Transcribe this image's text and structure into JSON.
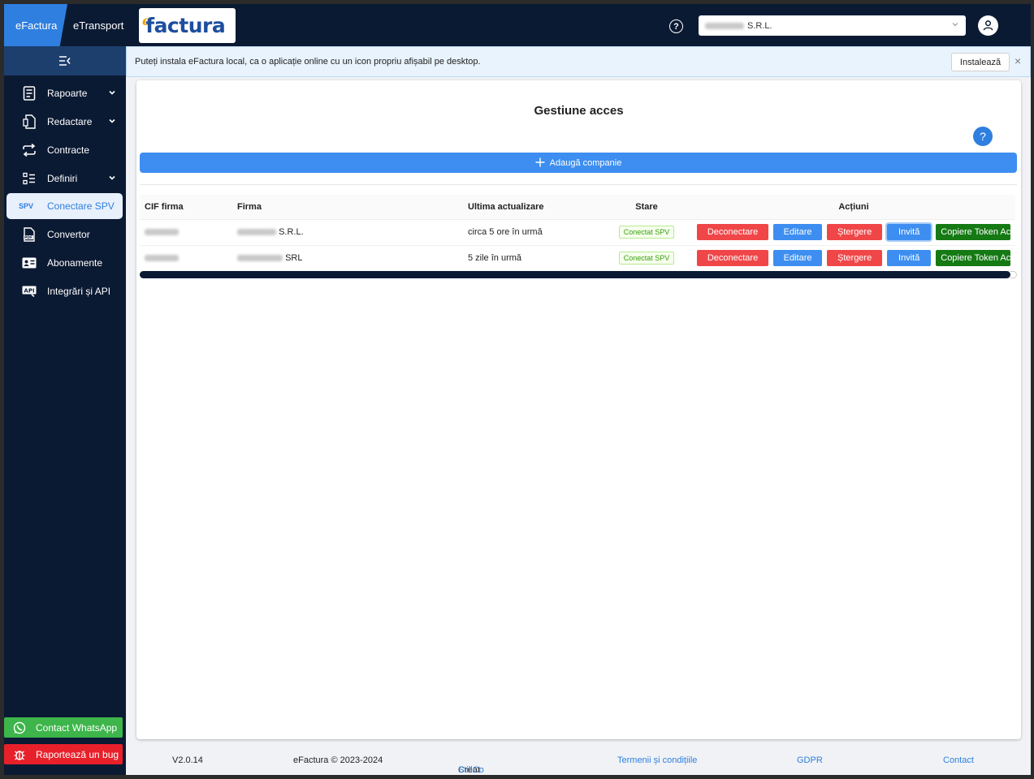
{
  "topbar": {
    "tab_efactura": "eFactura",
    "tab_etransport": "eTransport",
    "logo_prefix": "e",
    "logo_text": "factura",
    "company_suffix": "S.R.L.",
    "help_symbol": "?"
  },
  "sidebar": {
    "items": [
      {
        "label": "Rapoarte",
        "icon": "report-icon"
      },
      {
        "label": "Redactare",
        "icon": "edit-document-icon"
      },
      {
        "label": "Contracte",
        "icon": "repeat-icon"
      },
      {
        "label": "Definiri",
        "icon": "list-icon"
      },
      {
        "label": "Conectare SPV",
        "icon_text": "SPV"
      },
      {
        "label": "Convertor",
        "icon": "pdf-file-icon"
      },
      {
        "label": "Abonamente",
        "icon": "id-card-icon"
      },
      {
        "label": "Integrări și API",
        "icon": "api-icon"
      }
    ],
    "whatsapp": "Contact WhatsApp",
    "bug": "Raportează un bug"
  },
  "notice": {
    "text": "Puteți instala eFactura local, ca o aplicație online cu un icon propriu afișabil pe desktop.",
    "install": "Instalează",
    "close": "×"
  },
  "main": {
    "title": "Gestiune acces",
    "help_symbol": "?",
    "add_company": "Adaugă companie",
    "columns": [
      "CIF firma",
      "Firma",
      "Ultima actualizare",
      "Stare",
      "Acțiuni"
    ],
    "rows": [
      {
        "company_suffix": "S.R.L.",
        "updated": "circa 5 ore în urmă",
        "status": "Conectat SPV"
      },
      {
        "company_suffix": "SRL",
        "updated": "5 zile în urmă",
        "status": "Conectat SPV"
      }
    ],
    "actions": {
      "disconnect": "Deconectare",
      "edit": "Editare",
      "delete": "Ștergere",
      "invite": "Invită",
      "copy_token": "Copiere Token Ac"
    }
  },
  "footer": {
    "version": "V2.0.14",
    "copyright": "eFactura © 2023-2024",
    "created_by_prefix": "Creat de ",
    "created_by_link": "StillCo Software",
    "terms": "Termenii și condițiile",
    "gdpr": "GDPR",
    "contact": "Contact"
  },
  "colors": {
    "navy": "#0b1a33",
    "primary": "#3d8ef0",
    "danger": "#f04648",
    "success": "#157a14",
    "whatsapp": "#3db54a"
  }
}
